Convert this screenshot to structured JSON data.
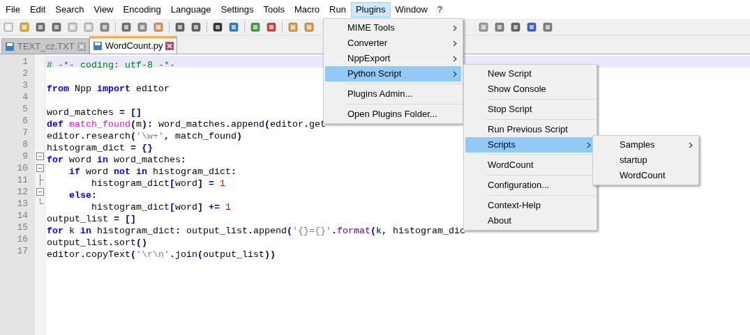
{
  "menu_bar": [
    {
      "label": "File",
      "selected": false
    },
    {
      "label": "Edit",
      "selected": false
    },
    {
      "label": "Search",
      "selected": false
    },
    {
      "label": "View",
      "selected": false
    },
    {
      "label": "Encoding",
      "selected": false
    },
    {
      "label": "Language",
      "selected": false
    },
    {
      "label": "Settings",
      "selected": false
    },
    {
      "label": "Tools",
      "selected": false
    },
    {
      "label": "Macro",
      "selected": false
    },
    {
      "label": "Run",
      "selected": false
    },
    {
      "label": "Plugins",
      "selected": true
    },
    {
      "label": "Window",
      "selected": false
    },
    {
      "label": "?",
      "selected": false
    }
  ],
  "tabs": [
    {
      "label": "TEXT_cz.TXT",
      "selected": false
    },
    {
      "label": "WordCount.py",
      "selected": true
    }
  ],
  "editor": {
    "lines": [
      {
        "number": "1",
        "current": true,
        "tokens": [
          {
            "kind": "comment",
            "text": "# -*- coding: utf-8 -*-"
          }
        ]
      },
      {
        "number": "2",
        "current": false
      },
      {
        "number": "3",
        "current": false,
        "tokens": [
          {
            "kind": "keyword",
            "text": "from"
          },
          {
            "kind": "plain",
            "text": " Npp "
          },
          {
            "kind": "keyword",
            "text": "import"
          },
          {
            "kind": "plain",
            "text": " editor"
          }
        ]
      },
      {
        "number": "4",
        "current": false
      },
      {
        "number": "5",
        "current": false,
        "tokens": [
          {
            "kind": "plain",
            "text": "word_matches "
          },
          {
            "kind": "operator",
            "text": "= []"
          }
        ]
      },
      {
        "number": "6",
        "current": false,
        "tokens": [
          {
            "kind": "keyword",
            "text": "def "
          },
          {
            "kind": "function",
            "text": "match_found"
          },
          {
            "kind": "operator",
            "text": "("
          },
          {
            "kind": "plain",
            "text": "m"
          },
          {
            "kind": "operator",
            "text": "):"
          },
          {
            "kind": "plain",
            "text": " word_matches"
          },
          {
            "kind": "operator",
            "text": "."
          },
          {
            "kind": "plain",
            "text": "append"
          },
          {
            "kind": "operator",
            "text": "("
          },
          {
            "kind": "plain",
            "text": "editor"
          },
          {
            "kind": "operator",
            "text": "."
          },
          {
            "kind": "plain",
            "text": "get"
          }
        ]
      },
      {
        "number": "7",
        "current": false,
        "tokens": [
          {
            "kind": "plain",
            "text": "editor"
          },
          {
            "kind": "operator",
            "text": "."
          },
          {
            "kind": "plain",
            "text": "research"
          },
          {
            "kind": "operator",
            "text": "("
          },
          {
            "kind": "string",
            "text": "'\\w+'"
          },
          {
            "kind": "operator",
            "text": ","
          },
          {
            "kind": "plain",
            "text": " match_found"
          },
          {
            "kind": "operator",
            "text": ")"
          }
        ]
      },
      {
        "number": "8",
        "current": false,
        "tokens": [
          {
            "kind": "plain",
            "text": "histogram_dict "
          },
          {
            "kind": "operator",
            "text": "= {}"
          }
        ]
      },
      {
        "number": "9",
        "current": false,
        "fold": {
          "kind": "open"
        },
        "tokens": [
          {
            "kind": "keyword",
            "text": "for"
          },
          {
            "kind": "plain",
            "text": " word "
          },
          {
            "kind": "keyword",
            "text": "in"
          },
          {
            "kind": "plain",
            "text": " word_matches"
          },
          {
            "kind": "operator",
            "text": ":"
          }
        ]
      },
      {
        "number": "10",
        "current": false,
        "fold": {
          "kind": "open"
        },
        "tokens": [
          {
            "kind": "keyword",
            "text": "    if"
          },
          {
            "kind": "plain",
            "text": " word "
          },
          {
            "kind": "keyword",
            "text": "not in"
          },
          {
            "kind": "plain",
            "text": " histogram_dict"
          },
          {
            "kind": "operator",
            "text": ":"
          }
        ]
      },
      {
        "number": "11",
        "current": false,
        "fold": {
          "kind": "line"
        },
        "tokens": [
          {
            "kind": "plain",
            "text": "        histogram_dict"
          },
          {
            "kind": "operator",
            "text": "["
          },
          {
            "kind": "plain",
            "text": "word"
          },
          {
            "kind": "operator",
            "text": "] = "
          },
          {
            "kind": "number",
            "text": "1"
          }
        ]
      },
      {
        "number": "12",
        "current": false,
        "fold": {
          "kind": "open"
        },
        "tokens": [
          {
            "kind": "keyword",
            "text": "    else"
          },
          {
            "kind": "operator",
            "text": ":"
          }
        ]
      },
      {
        "number": "13",
        "current": false,
        "fold": {
          "kind": "end"
        },
        "tokens": [
          {
            "kind": "plain",
            "text": "        histogram_dict"
          },
          {
            "kind": "operator",
            "text": "["
          },
          {
            "kind": "plain",
            "text": "word"
          },
          {
            "kind": "operator",
            "text": "] += "
          },
          {
            "kind": "number",
            "text": "1"
          }
        ]
      },
      {
        "number": "14",
        "current": false,
        "tokens": [
          {
            "kind": "plain",
            "text": "output_list "
          },
          {
            "kind": "operator",
            "text": "= []"
          }
        ]
      },
      {
        "number": "15",
        "current": false,
        "tokens": [
          {
            "kind": "keyword",
            "text": "for"
          },
          {
            "kind": "plain",
            "text": " k "
          },
          {
            "kind": "keyword",
            "text": "in"
          },
          {
            "kind": "plain",
            "text": " histogram_dict"
          },
          {
            "kind": "operator",
            "text": ":"
          },
          {
            "kind": "plain",
            "text": " output_list"
          },
          {
            "kind": "operator",
            "text": "."
          },
          {
            "kind": "plain",
            "text": "append"
          },
          {
            "kind": "operator",
            "text": "("
          },
          {
            "kind": "string",
            "text": "'{}={}'"
          },
          {
            "kind": "operator",
            "text": "."
          },
          {
            "kind": "function2",
            "text": "format"
          },
          {
            "kind": "operator",
            "text": "("
          },
          {
            "kind": "plain",
            "text": "k"
          },
          {
            "kind": "operator",
            "text": ","
          },
          {
            "kind": "plain",
            "text": " histogram_dic"
          }
        ]
      },
      {
        "number": "16",
        "current": false,
        "tokens": [
          {
            "kind": "plain",
            "text": "output_list"
          },
          {
            "kind": "operator",
            "text": "."
          },
          {
            "kind": "plain",
            "text": "sort"
          },
          {
            "kind": "operator",
            "text": "()"
          }
        ]
      },
      {
        "number": "17",
        "current": false,
        "tokens": [
          {
            "kind": "plain",
            "text": "editor"
          },
          {
            "kind": "operator",
            "text": "."
          },
          {
            "kind": "plain",
            "text": "copyText"
          },
          {
            "kind": "operator",
            "text": "("
          },
          {
            "kind": "string",
            "text": "'\\r\\n'"
          },
          {
            "kind": "operator",
            "text": "."
          },
          {
            "kind": "plain",
            "text": "join"
          },
          {
            "kind": "operator",
            "text": "("
          },
          {
            "kind": "plain",
            "text": "output_list"
          },
          {
            "kind": "operator",
            "text": "))"
          }
        ]
      }
    ]
  },
  "plugins_menu": [
    {
      "kind": "item",
      "label": "MIME Tools",
      "submenu": true,
      "selected": false
    },
    {
      "kind": "item",
      "label": "Converter",
      "submenu": true,
      "selected": false
    },
    {
      "kind": "item",
      "label": "NppExport",
      "submenu": true,
      "selected": false
    },
    {
      "kind": "item",
      "label": "Python Script",
      "submenu": true,
      "selected": true
    },
    {
      "kind": "separator"
    },
    {
      "kind": "item",
      "label": "Plugins Admin...",
      "submenu": false,
      "selected": false
    },
    {
      "kind": "separator"
    },
    {
      "kind": "item",
      "label": "Open Plugins Folder...",
      "submenu": false,
      "selected": false
    }
  ],
  "python_script_menu": [
    {
      "kind": "item",
      "label": "New Script",
      "submenu": false,
      "selected": false
    },
    {
      "kind": "item",
      "label": "Show Console",
      "submenu": false,
      "selected": false
    },
    {
      "kind": "separator"
    },
    {
      "kind": "item",
      "label": "Stop Script",
      "submenu": false,
      "selected": false
    },
    {
      "kind": "separator"
    },
    {
      "kind": "item",
      "label": "Run Previous Script",
      "submenu": false,
      "selected": false
    },
    {
      "kind": "item",
      "label": "Scripts",
      "submenu": true,
      "selected": true
    },
    {
      "kind": "separator"
    },
    {
      "kind": "item",
      "label": "WordCount",
      "submenu": false,
      "selected": false
    },
    {
      "kind": "separator"
    },
    {
      "kind": "item",
      "label": "Configuration...",
      "submenu": false,
      "selected": false
    },
    {
      "kind": "separator"
    },
    {
      "kind": "item",
      "label": "Context-Help",
      "submenu": false,
      "selected": false
    },
    {
      "kind": "item",
      "label": "About",
      "submenu": false,
      "selected": false
    }
  ],
  "scripts_menu": [
    {
      "kind": "item",
      "label": "Samples",
      "submenu": true,
      "selected": false
    },
    {
      "kind": "item",
      "label": "startup",
      "submenu": false,
      "selected": false
    },
    {
      "kind": "item",
      "label": "WordCount",
      "submenu": false,
      "selected": false
    }
  ]
}
